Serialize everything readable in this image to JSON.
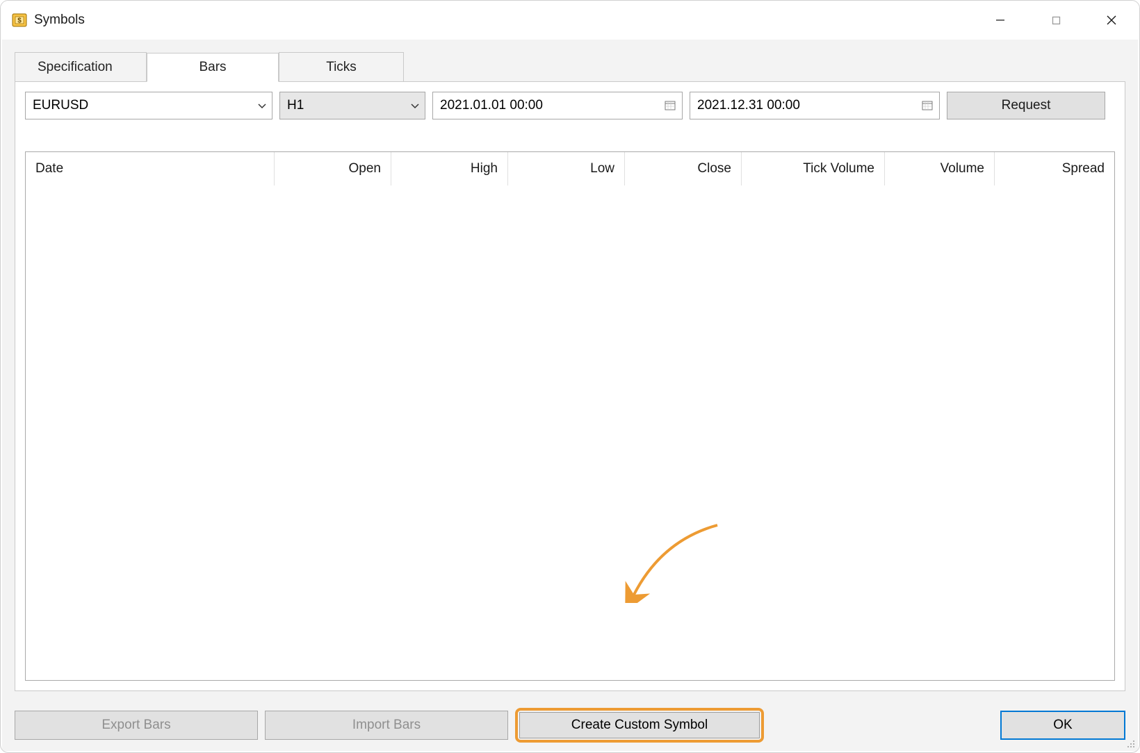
{
  "window": {
    "title": "Symbols"
  },
  "tabs": {
    "specification": "Specification",
    "bars": "Bars",
    "ticks": "Ticks",
    "active": "Bars"
  },
  "controls": {
    "symbol": "EURUSD",
    "timeframe": "H1",
    "date_from": "2021.01.01 00:00",
    "date_to": "2021.12.31 00:00",
    "request_label": "Request"
  },
  "table": {
    "columns": {
      "date": "Date",
      "open": "Open",
      "high": "High",
      "low": "Low",
      "close": "Close",
      "tick_volume": "Tick Volume",
      "volume": "Volume",
      "spread": "Spread"
    },
    "rows": []
  },
  "footer": {
    "export_bars": "Export Bars",
    "import_bars": "Import Bars",
    "create_custom_symbol": "Create Custom Symbol",
    "ok": "OK"
  },
  "annotation": {
    "highlight_target": "create-custom-symbol-button",
    "arrow_color": "#ed9b33"
  }
}
